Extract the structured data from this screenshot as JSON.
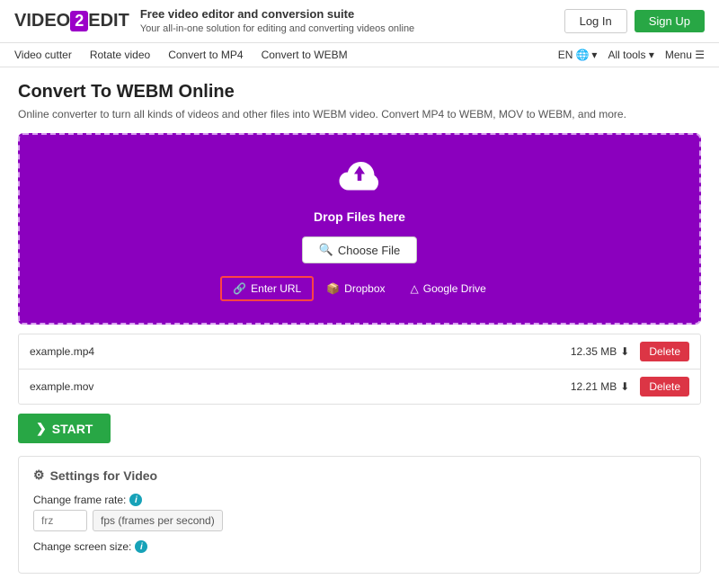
{
  "header": {
    "logo_text": "VIDEO",
    "logo_two": "2",
    "logo_edit": "EDIT",
    "tagline_strong": "Free video editor and conversion suite",
    "tagline_sub": "Your all-in-one solution for editing and converting videos online",
    "login_label": "Log In",
    "signup_label": "Sign Up"
  },
  "nav": {
    "items": [
      {
        "label": "Video cutter"
      },
      {
        "label": "Rotate video"
      },
      {
        "label": "Convert to MP4"
      },
      {
        "label": "Convert to WEBM"
      }
    ],
    "lang": "EN",
    "all_tools": "All tools",
    "menu": "Menu"
  },
  "main": {
    "page_title": "Convert To WEBM Online",
    "page_desc": "Online converter to turn all kinds of videos and other files into WEBM video. Convert MP4 to WEBM, MOV to WEBM, and more.",
    "upload": {
      "drop_text": "Drop Files here",
      "choose_file_label": "Choose File",
      "enter_url_label": "Enter URL",
      "dropbox_label": "Dropbox",
      "google_drive_label": "Google Drive"
    },
    "files": [
      {
        "name": "example.mp4",
        "size": "12.35 MB"
      },
      {
        "name": "example.mov",
        "size": "12.21 MB"
      }
    ],
    "delete_label": "Delete",
    "start_label": "START",
    "settings": {
      "title": "Settings for Video",
      "frame_rate_label": "Change frame rate:",
      "frame_rate_placeholder": "frz",
      "frame_rate_unit": "fps (frames per second)",
      "screen_size_label": "Change screen size:"
    }
  }
}
